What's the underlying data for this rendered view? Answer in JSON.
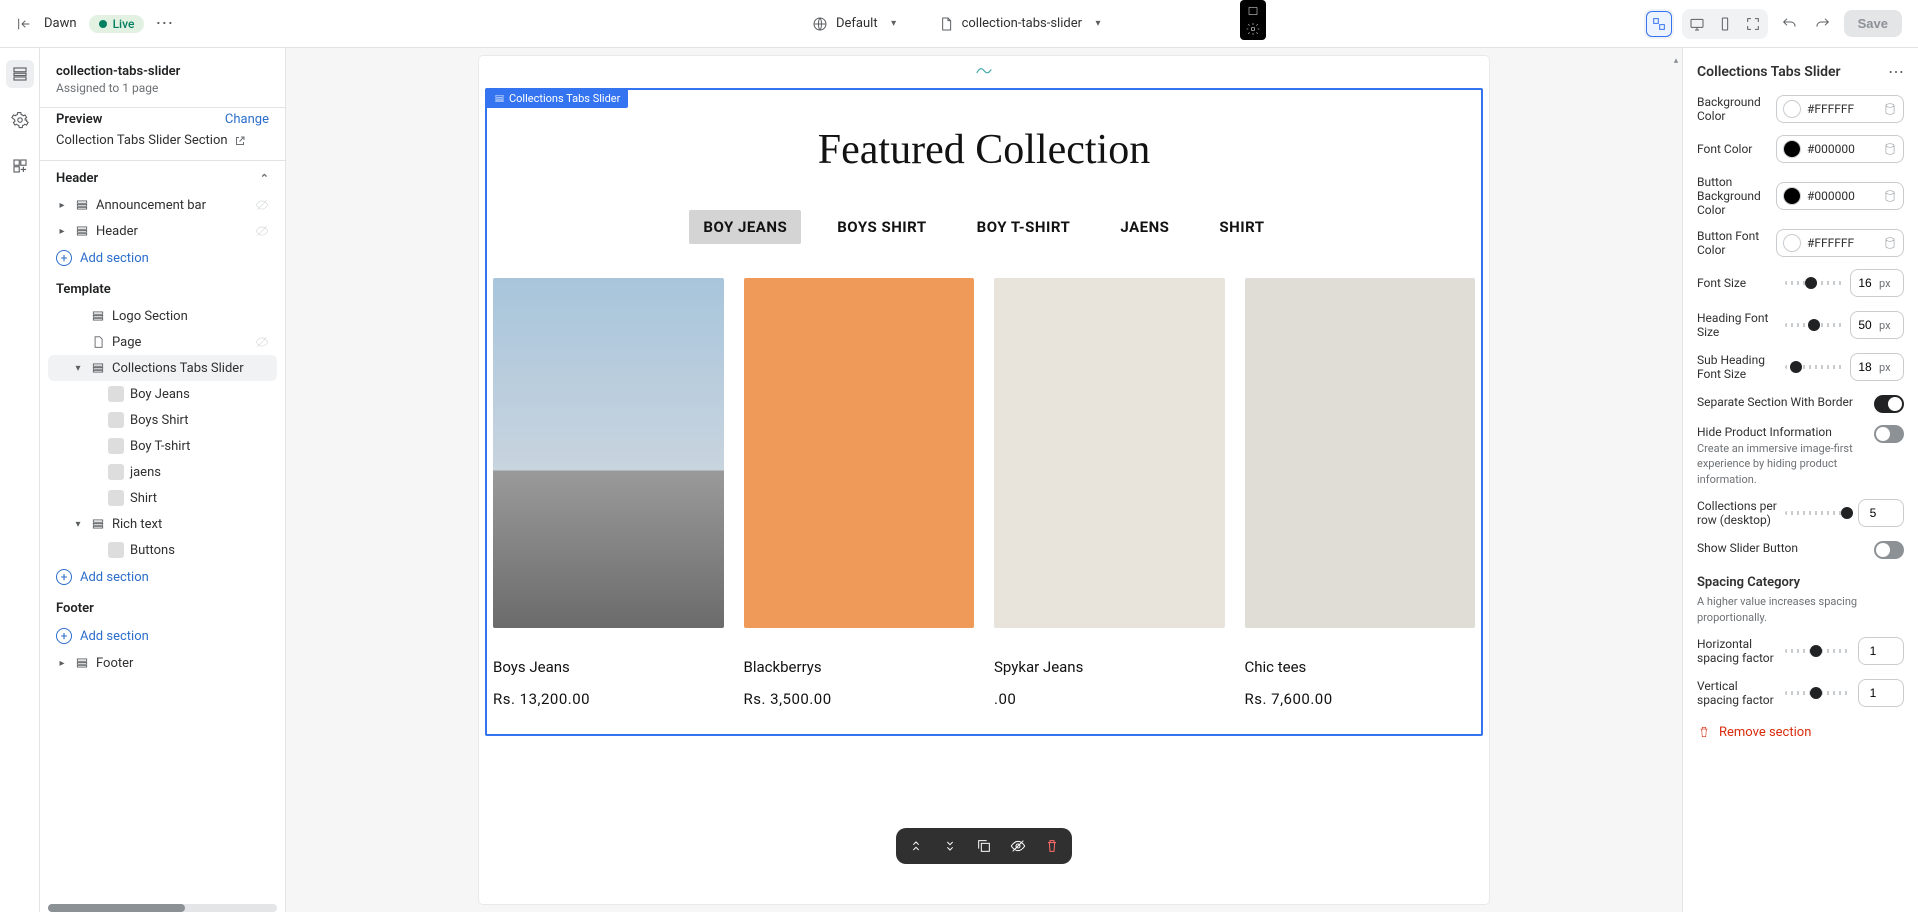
{
  "topbar": {
    "store_name": "Dawn",
    "live_badge": "Live",
    "default_label": "Default",
    "template_name": "collection-tabs-slider",
    "save_label": "Save"
  },
  "sidebar": {
    "title": "collection-tabs-slider",
    "assigned": "Assigned to 1 page",
    "preview_heading": "Preview",
    "change_link": "Change",
    "preview_value": "Collection Tabs Slider Section",
    "header_label": "Header",
    "header_items": [
      "Announcement bar",
      "Header"
    ],
    "add_section": "Add section",
    "template_label": "Template",
    "template_items": [
      {
        "label": "Logo Section",
        "type": "section",
        "indent": 1
      },
      {
        "label": "Page",
        "type": "page",
        "indent": 1,
        "eye": true
      },
      {
        "label": "Collections Tabs Slider",
        "type": "section",
        "indent": 1,
        "selected": true,
        "caret": "down"
      },
      {
        "label": "Boy Jeans",
        "type": "block",
        "indent": 2
      },
      {
        "label": "Boys Shirt",
        "type": "block",
        "indent": 2
      },
      {
        "label": "Boy T-shirt",
        "type": "block",
        "indent": 2
      },
      {
        "label": "jaens",
        "type": "block",
        "indent": 2
      },
      {
        "label": "Shirt",
        "type": "block",
        "indent": 2
      },
      {
        "label": "Rich text",
        "type": "section",
        "indent": 1,
        "caret": "down"
      },
      {
        "label": "Buttons",
        "type": "block",
        "indent": 2,
        "icon": "link"
      }
    ],
    "footer_label": "Footer",
    "footer_items": [
      "Footer"
    ]
  },
  "canvas": {
    "selection_tag": "Collections Tabs Slider",
    "heading": "Featured Collection",
    "tabs": [
      "BOY JEANS",
      "BOYS SHIRT",
      "BOY T-SHIRT",
      "JAENS",
      "SHIRT"
    ],
    "active_tab_index": 0,
    "products": [
      {
        "name": "Boys Jeans",
        "price": "Rs. 13,200.00"
      },
      {
        "name": "Blackberrys",
        "price": "Rs. 3,500.00"
      },
      {
        "name": "Spykar Jeans",
        "price": ".00"
      },
      {
        "name": "Chic tees",
        "price": "Rs. 7,600.00"
      }
    ]
  },
  "panel": {
    "title": "Collections Tabs Slider",
    "bg_color_label": "Background Color",
    "bg_color": "#FFFFFF",
    "font_color_label": "Font Color",
    "font_color": "#000000",
    "btn_bg_label": "Button Background Color",
    "btn_bg": "#000000",
    "btn_font_label": "Button Font Color",
    "btn_font": "#FFFFFF",
    "font_size_label": "Font Size",
    "font_size": "16",
    "heading_size_label": "Heading Font Size",
    "heading_size": "50",
    "sub_heading_size_label": "Sub Heading Font Size",
    "sub_heading_size": "18",
    "px": "px",
    "separate_border_label": "Separate Section With Border",
    "hide_info_label": "Hide Product Information",
    "hide_info_sub": "Create an immersive image-first experience by hiding product information.",
    "per_row_label": "Collections per row (desktop)",
    "per_row": "5",
    "show_slider_label": "Show Slider Button",
    "spacing_heading": "Spacing Category",
    "spacing_sub": "A higher value increases spacing proportionally.",
    "h_spacing_label": "Horizontal spacing factor",
    "h_spacing": "1",
    "v_spacing_label": "Vertical spacing factor",
    "v_spacing": "1",
    "remove_label": "Remove section"
  }
}
